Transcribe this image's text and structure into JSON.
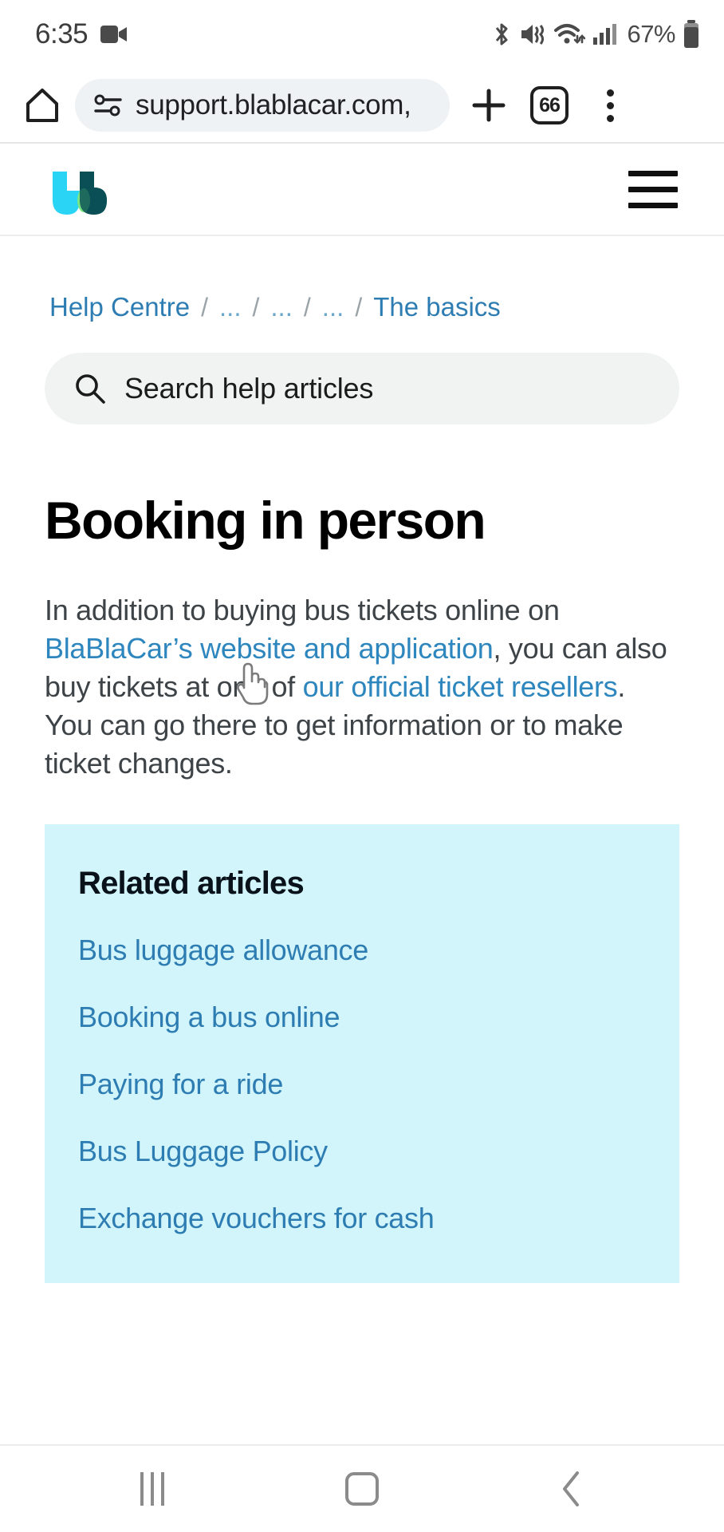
{
  "status_bar": {
    "time": "6:35",
    "battery_percent": "67%",
    "icons": [
      "video-camera-icon",
      "bluetooth-icon",
      "mute-vibrate-icon",
      "wifi-icon",
      "cellular-signal-icon",
      "battery-icon"
    ]
  },
  "browser": {
    "home_icon": "home-icon",
    "site_info_icon": "page-info-icon",
    "url": "support.blablacar.com,",
    "new_tab_icon": "plus-icon",
    "tab_count": "66",
    "menu_icon": "kebab-menu-icon"
  },
  "site_header": {
    "logo_name": "blablacar-logo",
    "menu_icon": "hamburger-menu-icon",
    "colors": {
      "logo_cyan": "#2ad4f5",
      "logo_dark": "#0a4f55",
      "logo_green": "#7ae582"
    }
  },
  "breadcrumb": {
    "items": [
      {
        "label": "Help Centre",
        "muted": false
      },
      {
        "label": "...",
        "muted": true
      },
      {
        "label": "...",
        "muted": true
      },
      {
        "label": "...",
        "muted": true
      },
      {
        "label": "The basics",
        "muted": false
      }
    ],
    "separator": "/"
  },
  "search": {
    "icon": "search-icon",
    "placeholder": "Search help articles",
    "value": ""
  },
  "article": {
    "title": "Booking in person",
    "body": {
      "seg1": "In addition to buying bus tickets online on ",
      "link1": "BlaBlaCar’s website and application",
      "seg2": ", you can also buy tickets at one of ",
      "link2": "our official ticket resellers",
      "seg3": ". You can go there to get information or to make ticket changes."
    }
  },
  "related": {
    "title": "Related articles",
    "links": [
      "Bus luggage allowance",
      "Booking a bus online",
      "Paying for a ride",
      "Bus Luggage Policy",
      "Exchange vouchers for cash"
    ],
    "background": "#d2f5fb"
  },
  "nav_bar": {
    "recents_label": "recents-button",
    "home_label": "home-button",
    "back_label": "back-button"
  },
  "cursor": {
    "type": "pointer-hand-cursor"
  },
  "theme": {
    "link_color": "#2d7db3",
    "body_text_color": "#3d4347",
    "search_bg": "#f1f2f2"
  }
}
